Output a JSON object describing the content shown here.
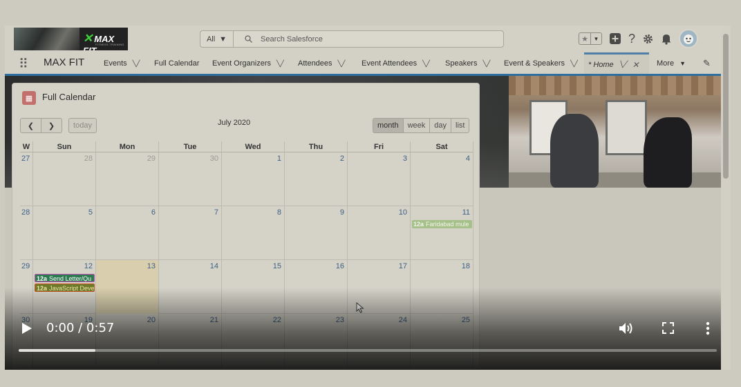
{
  "header": {
    "logo_text": "MAX FIT",
    "logo_tagline": "FITNESS TRAINING",
    "search_scope": "All",
    "search_placeholder": "Search Salesforce"
  },
  "nav": {
    "app_name": "MAX FIT",
    "items": [
      {
        "label": "Events",
        "has_menu": true
      },
      {
        "label": "Full Calendar",
        "has_menu": false
      },
      {
        "label": "Event Organizers",
        "has_menu": true
      },
      {
        "label": "Attendees",
        "has_menu": true
      },
      {
        "label": "Event Attendees",
        "has_menu": true
      },
      {
        "label": "Speakers",
        "has_menu": true
      },
      {
        "label": "Event & Speakers",
        "has_menu": true
      }
    ],
    "home_tab": "* Home",
    "more_label": "More"
  },
  "calendar": {
    "card_title": "Full Calendar",
    "month_label": "July 2020",
    "today_label": "today",
    "views": [
      "month",
      "week",
      "day",
      "list"
    ],
    "active_view": "month",
    "headers": [
      "W",
      "Sun",
      "Mon",
      "Tue",
      "Wed",
      "Thu",
      "Fri",
      "Sat"
    ],
    "weeks": [
      {
        "w": "27",
        "days": [
          {
            "d": "28",
            "other": true
          },
          {
            "d": "29",
            "other": true
          },
          {
            "d": "30",
            "other": true
          },
          {
            "d": "1"
          },
          {
            "d": "2"
          },
          {
            "d": "3"
          },
          {
            "d": "4"
          }
        ]
      },
      {
        "w": "28",
        "days": [
          {
            "d": "5"
          },
          {
            "d": "6"
          },
          {
            "d": "7"
          },
          {
            "d": "8"
          },
          {
            "d": "9"
          },
          {
            "d": "10"
          },
          {
            "d": "11",
            "events": [
              {
                "time": "12a",
                "title": "Faridabad mule",
                "color": "#a6c08a",
                "text": "#f4f4ea"
              }
            ]
          }
        ]
      },
      {
        "w": "29",
        "days": [
          {
            "d": "12",
            "events": [
              {
                "time": "12a",
                "title": "Send Letter/Qu",
                "color": "#2c7a50",
                "text": "#ffffff",
                "border": "#c54fb6"
              },
              {
                "time": "12a",
                "title": "JavaScript Deve",
                "color": "#6c7a2c",
                "text": "#f3e7a2",
                "border": "#c9541d"
              }
            ]
          },
          {
            "d": "13",
            "today": true
          },
          {
            "d": "14"
          },
          {
            "d": "15"
          },
          {
            "d": "16"
          },
          {
            "d": "17"
          },
          {
            "d": "18"
          }
        ]
      },
      {
        "w": "30",
        "days": [
          {
            "d": "19"
          },
          {
            "d": "20"
          },
          {
            "d": "21"
          },
          {
            "d": "22"
          },
          {
            "d": "23"
          },
          {
            "d": "24"
          },
          {
            "d": "25"
          }
        ]
      }
    ]
  },
  "video": {
    "time_display": "0:00 / 0:57",
    "progress": 0.11
  },
  "colors": {
    "accent": "#2f6f9f",
    "link": "#3c5f86",
    "today_bg": "#d9cfae"
  }
}
